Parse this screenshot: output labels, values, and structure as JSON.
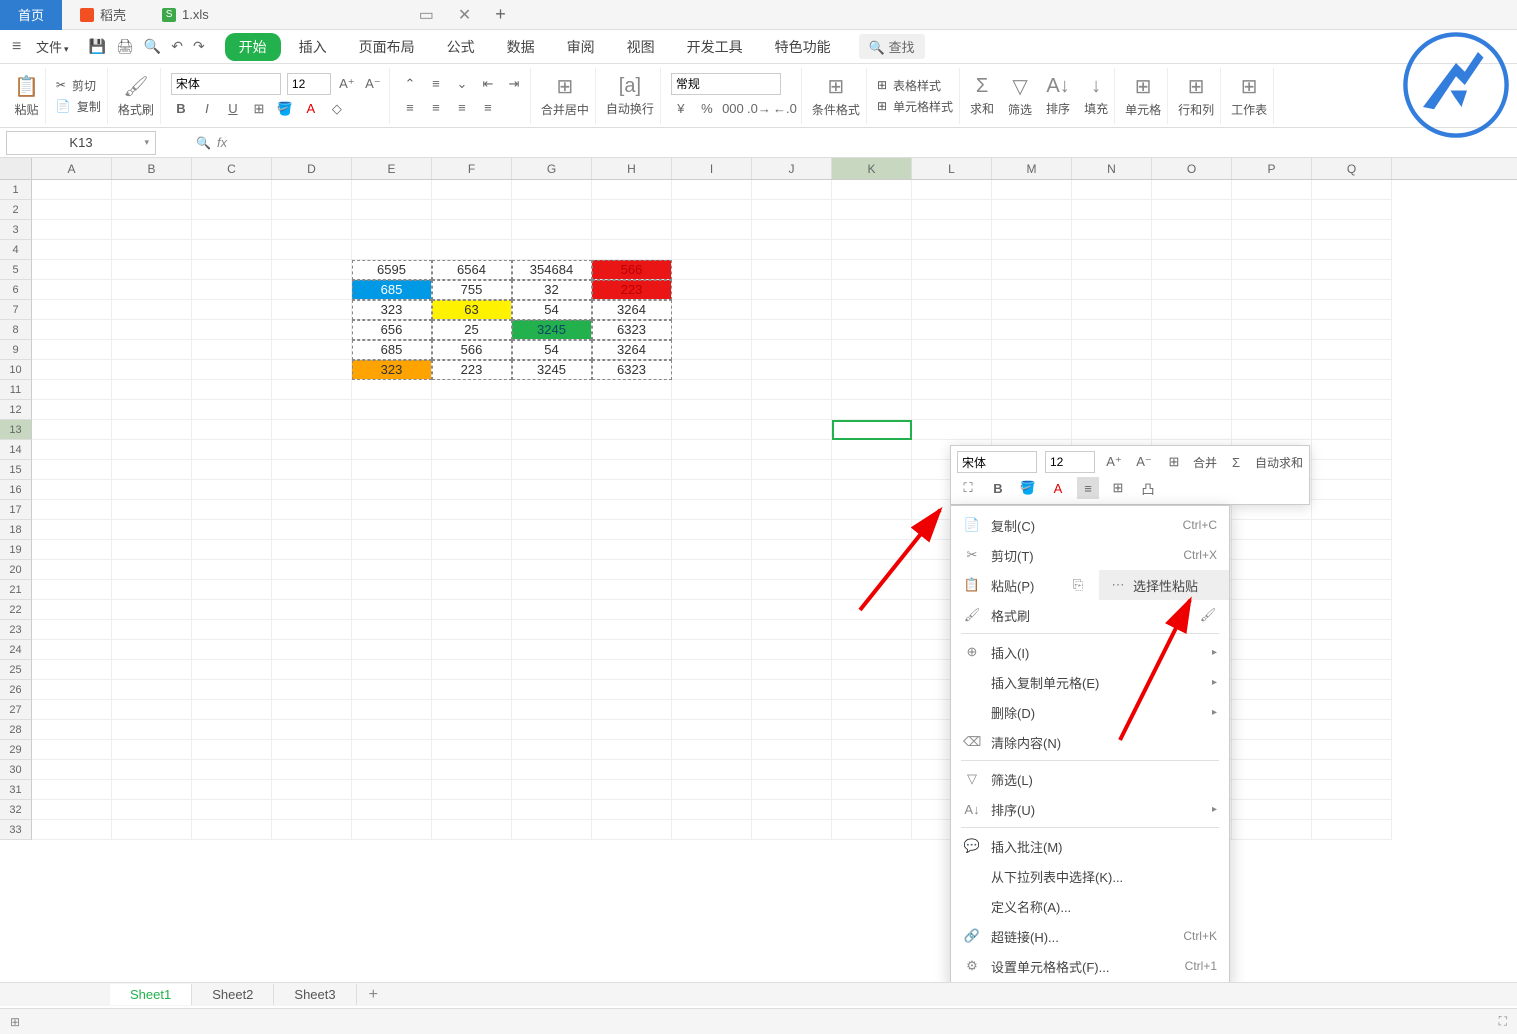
{
  "tabs": {
    "home": "首页",
    "docker": "稻壳",
    "file": "1.xls"
  },
  "fileMenu": "文件",
  "menuTabs": {
    "start": "开始",
    "insert": "插入",
    "layout": "页面布局",
    "formula": "公式",
    "data": "数据",
    "review": "审阅",
    "view": "视图",
    "dev": "开发工具",
    "special": "特色功能"
  },
  "search": "查找",
  "ribbon": {
    "paste": "粘贴",
    "cut": "剪切",
    "copy": "复制",
    "formatPainter": "格式刷",
    "font": "宋体",
    "fontSize": "12",
    "merge": "合并居中",
    "wrap": "自动换行",
    "numFmt": "常规",
    "condFmt": "条件格式",
    "tableStyle": "表格样式",
    "cellStyle": "单元格样式",
    "sum": "求和",
    "filter": "筛选",
    "sort": "排序",
    "fill": "填充",
    "cells": "单元格",
    "rowcol": "行和列",
    "worksheet": "工作表"
  },
  "nameBox": "K13",
  "columns": [
    "A",
    "B",
    "C",
    "D",
    "E",
    "F",
    "G",
    "H",
    "I",
    "J",
    "K",
    "L",
    "M",
    "N",
    "O",
    "P",
    "Q"
  ],
  "rowCount": 33,
  "selectedCol": 10,
  "selectedRow": 13,
  "cells": {
    "E5": {
      "v": "6595"
    },
    "F5": {
      "v": "6564"
    },
    "G5": {
      "v": "354684"
    },
    "H5": {
      "v": "566",
      "c": "red"
    },
    "E6": {
      "v": "685",
      "c": "blue"
    },
    "F6": {
      "v": "755"
    },
    "G6": {
      "v": "32"
    },
    "H6": {
      "v": "223",
      "c": "red"
    },
    "E7": {
      "v": "323"
    },
    "F7": {
      "v": "63",
      "c": "yellow"
    },
    "G7": {
      "v": "54"
    },
    "H7": {
      "v": "3264"
    },
    "E8": {
      "v": "656"
    },
    "F8": {
      "v": "25"
    },
    "G8": {
      "v": "3245",
      "c": "green"
    },
    "H8": {
      "v": "6323"
    },
    "E9": {
      "v": "685"
    },
    "F9": {
      "v": "566"
    },
    "G9": {
      "v": "54"
    },
    "H9": {
      "v": "3264"
    },
    "E10": {
      "v": "323",
      "c": "orange"
    },
    "F10": {
      "v": "223"
    },
    "G10": {
      "v": "3245"
    },
    "H10": {
      "v": "6323"
    }
  },
  "sheets": {
    "s1": "Sheet1",
    "s2": "Sheet2",
    "s3": "Sheet3"
  },
  "miniToolbar": {
    "font": "宋体",
    "size": "12",
    "merge": "合并",
    "autosum": "自动求和"
  },
  "contextMenu": {
    "copy": "复制(C)",
    "copyKey": "Ctrl+C",
    "cut": "剪切(T)",
    "cutKey": "Ctrl+X",
    "paste": "粘贴(P)",
    "pasteSpecial": "选择性粘贴",
    "formatPainter": "格式刷",
    "insert": "插入(I)",
    "insertCopied": "插入复制单元格(E)",
    "delete": "删除(D)",
    "clear": "清除内容(N)",
    "filter": "筛选(L)",
    "sort": "排序(U)",
    "comment": "插入批注(M)",
    "dropdown": "从下拉列表中选择(K)...",
    "defineName": "定义名称(A)...",
    "hyperlink": "超链接(H)...",
    "hyperlinkKey": "Ctrl+K",
    "formatCells": "设置单元格格式(F)...",
    "formatCellsKey": "Ctrl+1"
  }
}
